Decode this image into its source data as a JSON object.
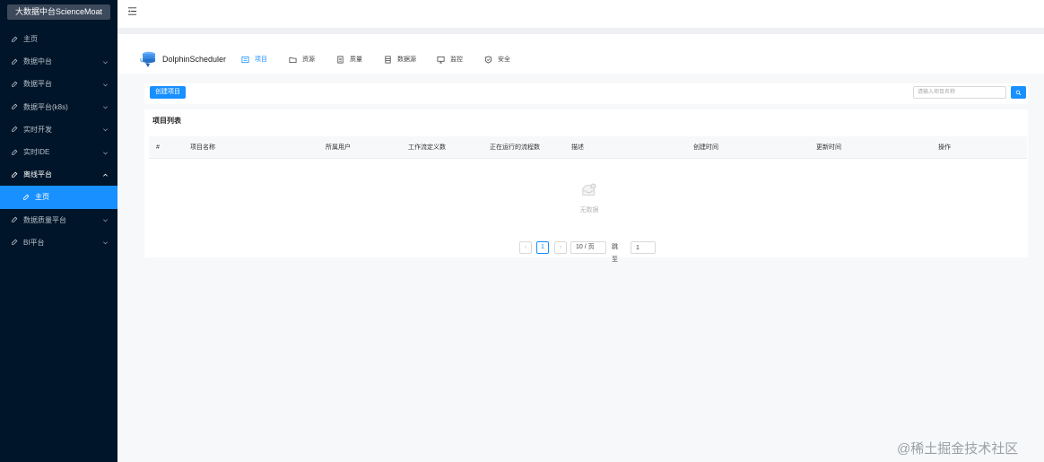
{
  "sidebar": {
    "brand": "大数据中台ScienceMoat",
    "items": [
      {
        "label": "主页",
        "has_arrow": false
      },
      {
        "label": "数据中台",
        "has_arrow": true
      },
      {
        "label": "数据平台",
        "has_arrow": true
      },
      {
        "label": "数据平台(k8s)",
        "has_arrow": true
      },
      {
        "label": "实时开发",
        "has_arrow": true
      },
      {
        "label": "实时IDE",
        "has_arrow": true
      },
      {
        "label": "离线平台",
        "has_arrow": true,
        "open": true
      },
      {
        "label": "主页",
        "sub": true,
        "active": true
      },
      {
        "label": "数据质量平台",
        "has_arrow": true
      },
      {
        "label": "BI平台",
        "has_arrow": true
      }
    ]
  },
  "dolphin": {
    "title": "DolphinScheduler",
    "tabs": [
      {
        "label": "项目",
        "icon": "project-icon",
        "active": true
      },
      {
        "label": "资源",
        "icon": "folder-icon"
      },
      {
        "label": "质量",
        "icon": "document-icon"
      },
      {
        "label": "数据源",
        "icon": "database-icon"
      },
      {
        "label": "监控",
        "icon": "monitor-icon"
      },
      {
        "label": "安全",
        "icon": "shield-icon"
      }
    ]
  },
  "toolbar": {
    "create_label": "创建项目",
    "search_placeholder": "请输入项目名称"
  },
  "project_list": {
    "title": "项目列表",
    "columns": [
      "#",
      "项目名称",
      "所属用户",
      "工作流定义数",
      "正在运行的流程数",
      "描述",
      "创建时间",
      "更新时间",
      "操作"
    ],
    "rows": [],
    "empty_text": "无数据"
  },
  "pagination": {
    "prev": "‹",
    "current_page": "1",
    "next": "›",
    "page_size": "10 / 页",
    "jump_label": "跳至",
    "jump_value": "1"
  },
  "watermark": "@稀土掘金技术社区",
  "colors": {
    "sidebar_bg": "#001529",
    "accent": "#1890ff"
  }
}
